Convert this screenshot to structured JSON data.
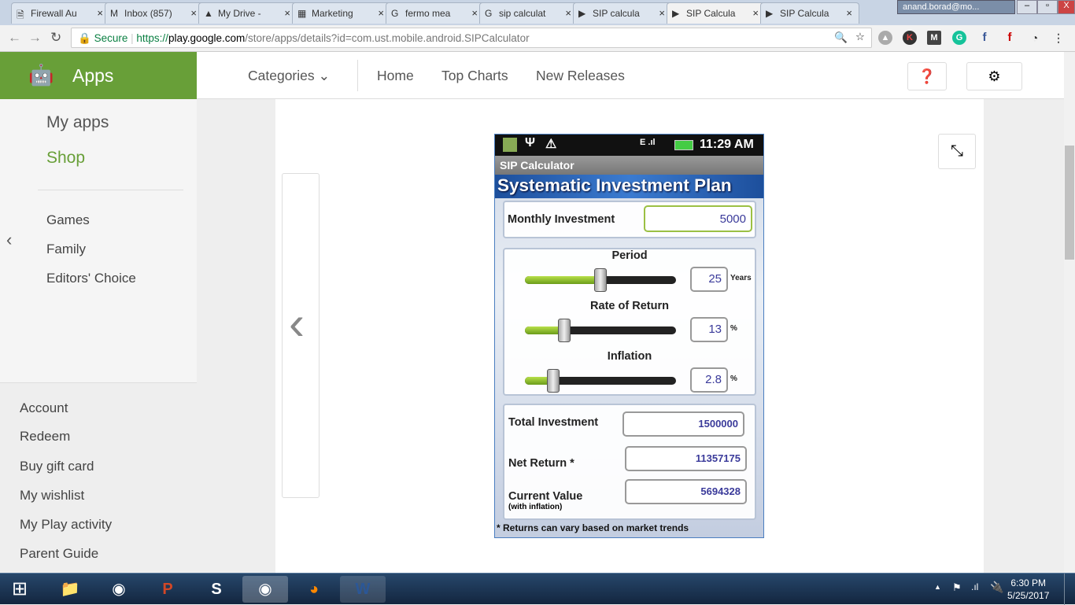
{
  "browser": {
    "tabs": [
      {
        "title": "Firewall Au",
        "icon": "document-icon"
      },
      {
        "title": "Inbox (857)",
        "icon": "gmail-icon"
      },
      {
        "title": "My Drive -",
        "icon": "drive-icon"
      },
      {
        "title": "Marketing",
        "icon": "sheets-icon"
      },
      {
        "title": "fermo mea",
        "icon": "google-icon"
      },
      {
        "title": "sip calculat",
        "icon": "google-icon"
      },
      {
        "title": "SIP calcula",
        "icon": "play-icon"
      },
      {
        "title": "SIP Calcula",
        "icon": "play-icon",
        "active": true
      },
      {
        "title": "SIP Calcula",
        "icon": "play-icon"
      }
    ],
    "user": "anand.borad@mo...",
    "secure_label": "Secure",
    "url_scheme": "https://",
    "url_host": "play.google.com",
    "url_path": "/store/apps/details?id=com.ust.mobile.android.SIPCalculator"
  },
  "play": {
    "section": "Apps",
    "nav": {
      "categories": "Categories",
      "home": "Home",
      "top_charts": "Top Charts",
      "new_releases": "New Releases"
    },
    "sidebar": {
      "primary": [
        "My apps",
        "Shop"
      ],
      "secondary": [
        "Games",
        "Family",
        "Editors' Choice"
      ],
      "account": [
        "Account",
        "Redeem",
        "Buy gift card",
        "My wishlist",
        "My Play activity",
        "Parent Guide"
      ]
    },
    "accent": "#689f38"
  },
  "app": {
    "time": "11:29 AM",
    "title": "SIP Calculator",
    "banner": "Systematic Investment Plan",
    "monthly_label": "Monthly Investment",
    "monthly_value": "5000",
    "sliders": [
      {
        "label": "Period",
        "value": "25",
        "unit": "Years",
        "fill_percent": 50
      },
      {
        "label": "Rate of Return",
        "value": "13",
        "unit": "%",
        "fill_percent": 26
      },
      {
        "label": "Inflation",
        "value": "2.8",
        "unit": "%",
        "fill_percent": 19
      }
    ],
    "results": [
      {
        "label": "Total Investment",
        "value": "1500000"
      },
      {
        "label": "Net Return *",
        "value": "11357175"
      },
      {
        "label": "Current Value",
        "sub": "(with inflation)",
        "value": "5694328"
      }
    ],
    "footnote": "* Returns can vary based on market trends"
  },
  "taskbar": {
    "time": "6:30 PM",
    "date": "5/25/2017"
  }
}
